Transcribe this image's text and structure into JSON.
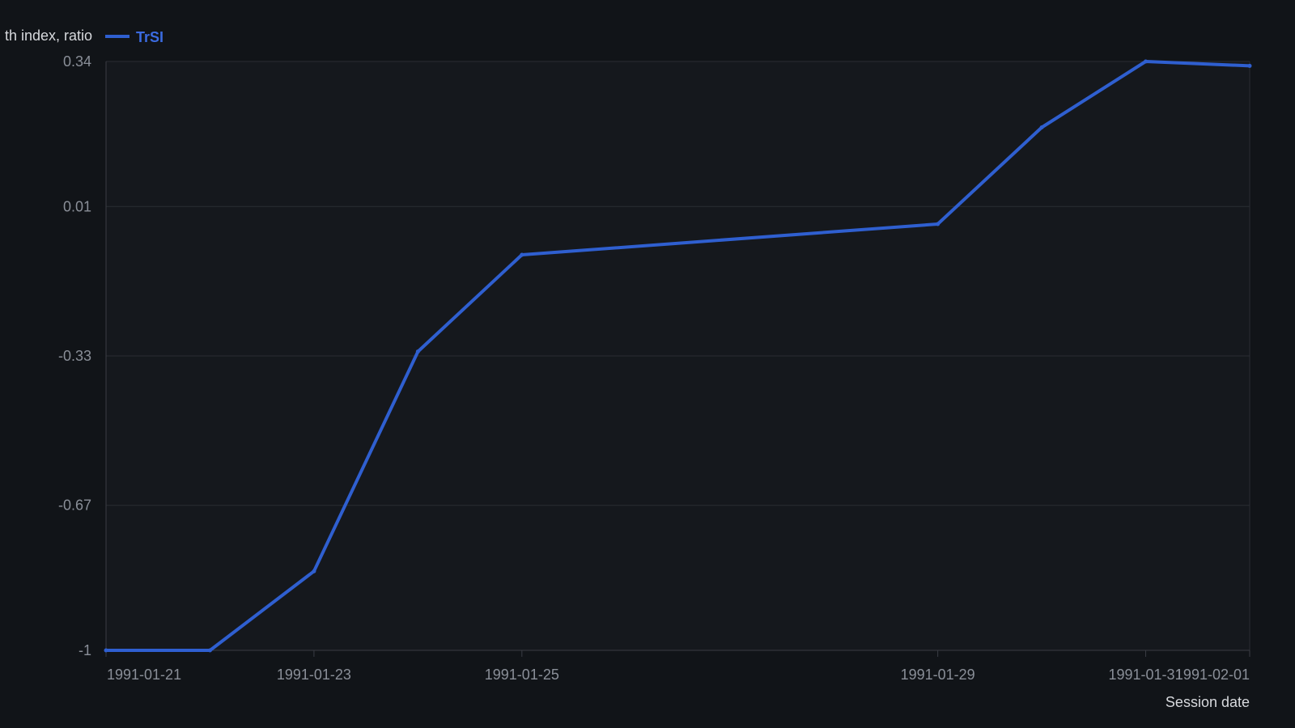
{
  "chart_data": {
    "type": "line",
    "x": [
      "1991-01-21",
      "1991-01-22",
      "1991-01-23",
      "1991-01-24",
      "1991-01-25",
      "1991-01-29",
      "1991-01-30",
      "1991-01-31",
      "1991-02-01"
    ],
    "series": [
      {
        "name": "TrSI",
        "values": [
          -1,
          -1,
          -0.82,
          -0.32,
          -0.1,
          -0.03,
          0.19,
          0.34,
          0.33
        ]
      }
    ],
    "x_ticks": [
      "1991-01-21",
      "1991-01-23",
      "1991-01-25",
      "1991-01-29",
      "1991-01-31",
      "1991-02-01"
    ],
    "y_ticks": [
      -1,
      -0.67,
      -0.33,
      0.01,
      0.34
    ],
    "y_tick_labels": [
      "-1",
      "-0.67",
      "-0.33",
      "0.01",
      "0.34"
    ],
    "ylim": [
      -1,
      0.34
    ],
    "xlim": [
      "1991-01-21",
      "1991-02-01"
    ],
    "ylabel": "th index, ratio",
    "xlabel": "Session date",
    "grid": true,
    "legend_position": "top-left",
    "colors": {
      "background": "#111418",
      "plot_background": "#15181d",
      "grid": "#2a2d33",
      "axis": "#3a3d44",
      "line": "#2f5fd0",
      "legend_text": "#3b6be0"
    }
  }
}
